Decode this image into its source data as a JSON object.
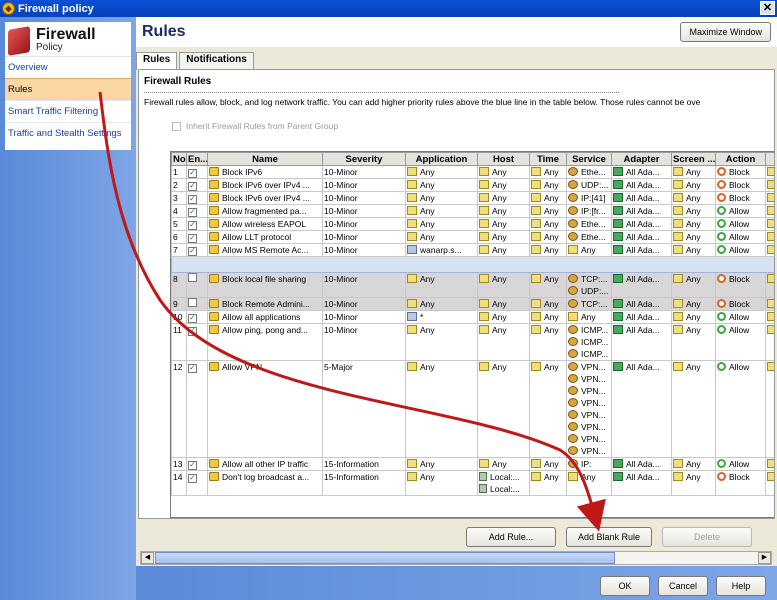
{
  "window": {
    "title": "Firewall policy",
    "close": "✕"
  },
  "brand": {
    "title": "Firewall",
    "subtitle": "Policy"
  },
  "sidebar": {
    "items": [
      {
        "label": "Overview",
        "active": false
      },
      {
        "label": "Rules",
        "active": true
      },
      {
        "label": "Smart Traffic Filtering",
        "active": false
      },
      {
        "label": "Traffic and Stealth Settings",
        "active": false
      }
    ]
  },
  "header": {
    "title": "Rules",
    "maximize_label": "Maximize Window"
  },
  "tabs": [
    "Rules",
    "Notifications"
  ],
  "section": {
    "title": "Firewall Rules",
    "description": "Firewall rules allow, block, and log network traffic. You can add higher priority rules above the blue line in the table below. Those rules cannot be ove",
    "inherit_label": "Inherit Firewall Rules from Parent Group"
  },
  "table": {
    "columns": [
      "No",
      "En...",
      "Name",
      "Severity",
      "Application",
      "Host",
      "Time",
      "Service",
      "Adapter",
      "Screen ...",
      "Action"
    ],
    "rows": [
      {
        "no": "1",
        "enabled": true,
        "name": "Block IPv6",
        "severity": "10-Minor",
        "application": "Any",
        "host": [
          "Any"
        ],
        "time": "Any",
        "service": [
          "Ethe..."
        ],
        "adapter": "All Ada...",
        "screen": "Any",
        "action": "Block",
        "style": ""
      },
      {
        "no": "2",
        "enabled": true,
        "name": "Block IPv6 over IPv4 ...",
        "severity": "10-Minor",
        "application": "Any",
        "host": [
          "Any"
        ],
        "time": "Any",
        "service": [
          "UDP:..."
        ],
        "adapter": "All Ada...",
        "screen": "Any",
        "action": "Block",
        "style": ""
      },
      {
        "no": "3",
        "enabled": true,
        "name": "Block IPv6 over IPv4 ...",
        "severity": "10-Minor",
        "application": "Any",
        "host": [
          "Any"
        ],
        "time": "Any",
        "service": [
          "IP:[41]"
        ],
        "adapter": "All Ada...",
        "screen": "Any",
        "action": "Block",
        "style": ""
      },
      {
        "no": "4",
        "enabled": true,
        "name": "Allow fragmented pa...",
        "severity": "10-Minor",
        "application": "Any",
        "host": [
          "Any"
        ],
        "time": "Any",
        "service": [
          "IP:[fr..."
        ],
        "adapter": "All Ada...",
        "screen": "Any",
        "action": "Allow",
        "style": ""
      },
      {
        "no": "5",
        "enabled": true,
        "name": "Allow wireless EAPOL",
        "severity": "10-Minor",
        "application": "Any",
        "host": [
          "Any"
        ],
        "time": "Any",
        "service": [
          "Ethe..."
        ],
        "adapter": "All Ada...",
        "screen": "Any",
        "action": "Allow",
        "style": ""
      },
      {
        "no": "6",
        "enabled": true,
        "name": "Allow LLT protocol",
        "severity": "10-Minor",
        "application": "Any",
        "host": [
          "Any"
        ],
        "time": "Any",
        "service": [
          "Ethe..."
        ],
        "adapter": "All Ada...",
        "screen": "Any",
        "action": "Allow",
        "style": ""
      },
      {
        "no": "7",
        "enabled": true,
        "name": "Allow MS Remote Ac...",
        "severity": "10-Minor",
        "application": "wanarp.s...",
        "host": [
          "Any"
        ],
        "time": "Any",
        "service": [
          "Any"
        ],
        "adapter": "All Ada...",
        "screen": "Any",
        "action": "Allow",
        "style": ""
      },
      {
        "separator": true
      },
      {
        "no": "8",
        "enabled": false,
        "name": "Block local file sharing",
        "severity": "10-Minor",
        "application": "Any",
        "host": [
          "Any"
        ],
        "time": "Any",
        "service": [
          "TCP:...",
          "UDP:..."
        ],
        "adapter": "All Ada...",
        "screen": "Any",
        "action": "Block",
        "style": "grey"
      },
      {
        "no": "9",
        "enabled": false,
        "name": "Block Remote Admini...",
        "severity": "10-Minor",
        "application": "Any",
        "host": [
          "Any"
        ],
        "time": "Any",
        "service": [
          "TCP:..."
        ],
        "adapter": "All Ada...",
        "screen": "Any",
        "action": "Block",
        "style": "grey"
      },
      {
        "no": "10",
        "enabled": true,
        "name": "Allow all applications",
        "severity": "10-Minor",
        "application": "*",
        "host": [
          "Any"
        ],
        "time": "Any",
        "service": [
          "Any"
        ],
        "adapter": "All Ada...",
        "screen": "Any",
        "action": "Allow",
        "style": ""
      },
      {
        "no": "11",
        "enabled": true,
        "name": "Allow ping, pong and...",
        "severity": "10-Minor",
        "application": "Any",
        "host": [
          "Any"
        ],
        "time": "Any",
        "service": [
          "ICMP...",
          "ICMP...",
          "ICMP..."
        ],
        "adapter": "All Ada...",
        "screen": "Any",
        "action": "Allow",
        "style": ""
      },
      {
        "no": "12",
        "enabled": true,
        "name": "Allow VPN",
        "severity": "5-Major",
        "application": "Any",
        "host": [
          "Any"
        ],
        "time": "Any",
        "service": [
          "VPN...",
          "VPN...",
          "VPN...",
          "VPN...",
          "VPN...",
          "VPN...",
          "VPN...",
          "VPN..."
        ],
        "adapter": "All Ada...",
        "screen": "Any",
        "action": "Allow",
        "style": ""
      },
      {
        "no": "13",
        "enabled": true,
        "name": "Allow all other IP traffic",
        "severity": "15-Information",
        "application": "Any",
        "host": [
          "Any"
        ],
        "time": "Any",
        "service": [
          "IP:"
        ],
        "adapter": "All Ada...",
        "screen": "Any",
        "action": "Allow",
        "style": ""
      },
      {
        "no": "14",
        "enabled": true,
        "name": "Don't log broadcast a...",
        "severity": "15-Information",
        "application": "Any",
        "host": [
          "Local:...",
          "Local:..."
        ],
        "time": "Any",
        "service": [
          "Any"
        ],
        "adapter": "All Ada...",
        "screen": "Any",
        "action": "Block",
        "style": ""
      }
    ]
  },
  "table_buttons": {
    "add_rule": "Add Rule...",
    "add_blank_rule": "Add Blank Rule",
    "delete": "Delete"
  },
  "footer": {
    "ok": "OK",
    "cancel": "Cancel",
    "help": "Help"
  },
  "colors": {
    "titlebar": "#0a4fd6",
    "sidebar_bg": "#5a8ad8",
    "active_nav": "#fbd7a5",
    "annotation_arrow": "#c01818",
    "blue_line": "#d6e2f2"
  }
}
